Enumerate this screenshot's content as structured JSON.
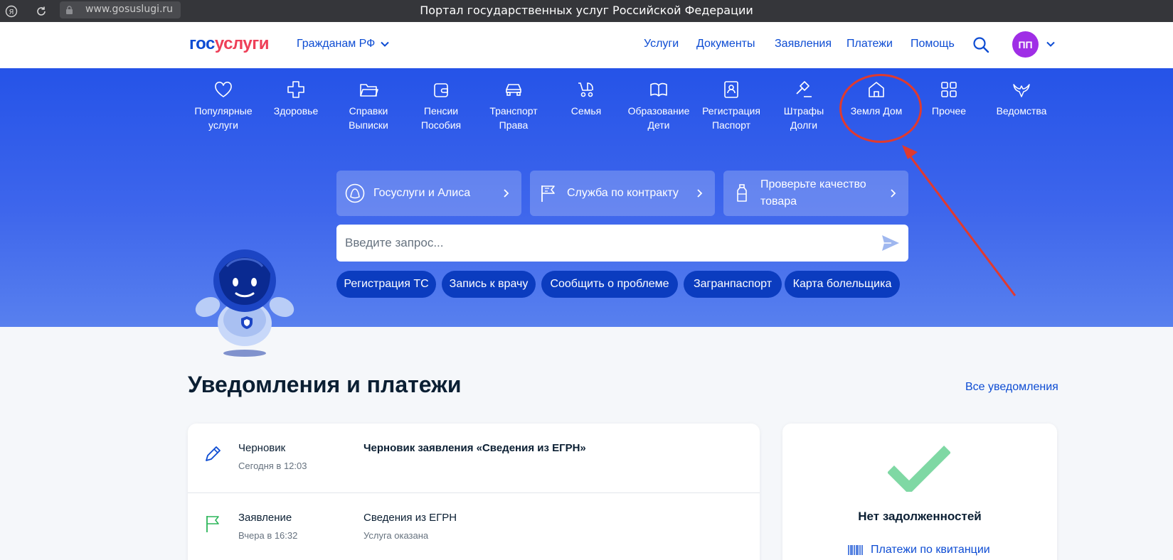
{
  "browser": {
    "url": "www.gosuslugi.ru",
    "window_title": "Портал государственных услуг Российской Федерации"
  },
  "header": {
    "logo_part1": "гос",
    "logo_part2": "услуги",
    "citizens_label": "Гражданам РФ",
    "nav": [
      "Услуги",
      "Документы",
      "Заявления",
      "Платежи",
      "Помощь"
    ],
    "avatar_initials": "ПП"
  },
  "categories": [
    {
      "l1": "Популярные",
      "l2": "услуги",
      "icon": "heart-icon"
    },
    {
      "l1": "Здоровье",
      "l2": "",
      "icon": "medical-cross-icon"
    },
    {
      "l1": "Справки",
      "l2": "Выписки",
      "icon": "folder-icon"
    },
    {
      "l1": "Пенсии",
      "l2": "Пособия",
      "icon": "wallet-icon"
    },
    {
      "l1": "Транспорт",
      "l2": "Права",
      "icon": "car-icon"
    },
    {
      "l1": "Семья",
      "l2": "",
      "icon": "stroller-icon"
    },
    {
      "l1": "Образование",
      "l2": "Дети",
      "icon": "book-icon"
    },
    {
      "l1": "Регистрация",
      "l2": "Паспорт",
      "icon": "id-card-icon"
    },
    {
      "l1": "Штрафы",
      "l2": "Долги",
      "icon": "gavel-icon"
    },
    {
      "l1": "Земля Дом",
      "l2": "",
      "icon": "house-icon"
    },
    {
      "l1": "Прочее",
      "l2": "",
      "icon": "grid-icon"
    },
    {
      "l1": "Ведомства",
      "l2": "",
      "icon": "eagle-icon"
    }
  ],
  "quick_links": [
    {
      "label": "Госуслуги и Алиса",
      "icon": "alice-icon"
    },
    {
      "label": "Служба по контракту",
      "icon": "flag-icon"
    },
    {
      "label": "Проверьте качество товара",
      "icon": "bottle-icon"
    }
  ],
  "search": {
    "placeholder": "Введите запрос..."
  },
  "chips": [
    "Регистрация ТС",
    "Запись к врачу",
    "Сообщить о проблеме",
    "Загранпаспорт",
    "Карта болельщика"
  ],
  "section": {
    "title": "Уведомления и платежи",
    "all_link": "Все уведомления"
  },
  "notifications": [
    {
      "type": "Черновик",
      "time": "Сегодня в 12:03",
      "title": "Черновик заявления «Сведения из ЕГРН»",
      "status": ""
    },
    {
      "type": "Заявление",
      "time": "Вчера в 16:32",
      "title": "Сведения из ЕГРН",
      "status": "Услуга оказана"
    }
  ],
  "debt": {
    "title": "Нет задолженностей",
    "link": "Платежи по квитанции"
  },
  "colors": {
    "brand_blue": "#0d4cd3",
    "brand_red": "#ee3f58",
    "annotation_red": "#e03a2f",
    "success_green": "#7fd8a4"
  }
}
